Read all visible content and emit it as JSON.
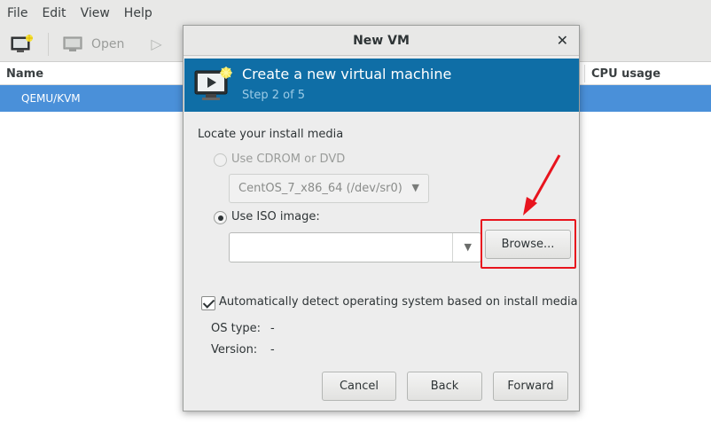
{
  "menubar": {
    "items": [
      "File",
      "Edit",
      "View",
      "Help"
    ]
  },
  "toolbar": {
    "open_label": "Open"
  },
  "vm_list": {
    "columns": [
      "Name",
      "CPU usage"
    ],
    "rows": [
      "QEMU/KVM"
    ]
  },
  "dialog": {
    "title": "New VM",
    "banner_title": "Create a new virtual machine",
    "banner_step": "Step 2 of 5",
    "section_label": "Locate your install media",
    "cdrom_option": "Use CDROM or DVD",
    "cdrom_device": "CentOS_7_x86_64 (/dev/sr0)",
    "iso_option": "Use ISO image:",
    "iso_value": "",
    "browse_label": "Browse...",
    "auto_detect_label": "Automatically detect operating system based on install media",
    "os_type_label": "OS type:",
    "os_type_value": "-",
    "version_label": "Version:",
    "version_value": "-",
    "cancel_label": "Cancel",
    "back_label": "Back",
    "forward_label": "Forward"
  },
  "colors": {
    "banner": "#0f6ea6",
    "selection": "#4a90d9",
    "annotation": "#e8141e"
  },
  "icons": [
    "new-vm-icon",
    "monitor-icon",
    "play-icon",
    "close-icon",
    "dropdown-arrow-icon",
    "annotation-arrow"
  ]
}
